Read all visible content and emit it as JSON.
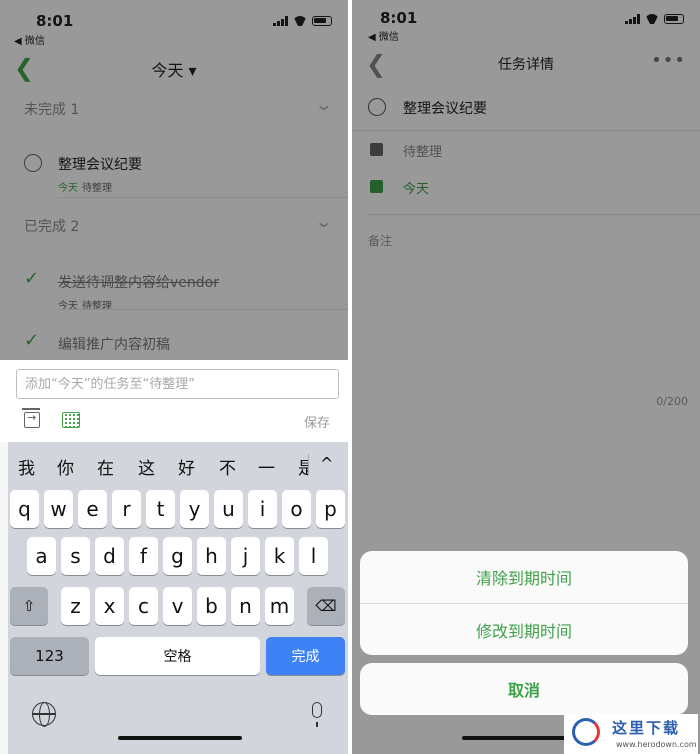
{
  "left": {
    "status": {
      "time": "8:01",
      "back_app": "◀ 微信"
    },
    "nav": {
      "title": "今天 ▾"
    },
    "sections": [
      {
        "label": "未完成 1"
      },
      {
        "label": "已完成 2"
      }
    ],
    "pending_tasks": [
      {
        "title": "整理会议纪要",
        "date": "今天",
        "list": "待整理"
      }
    ],
    "done_tasks": [
      {
        "title": "发送待调整内容给vendor",
        "date": "今天",
        "list": "待整理"
      },
      {
        "title": "编辑推广内容初稿"
      }
    ],
    "input": {
      "placeholder": "添加“今天”的任务至“待整理”"
    },
    "save_label": "保存",
    "keyboard": {
      "candidates": [
        "我",
        "你",
        "在",
        "这",
        "好",
        "不",
        "一",
        "是"
      ],
      "row1": [
        "q",
        "w",
        "e",
        "r",
        "t",
        "y",
        "u",
        "i",
        "o",
        "p"
      ],
      "row2": [
        "a",
        "s",
        "d",
        "f",
        "g",
        "h",
        "j",
        "k",
        "l"
      ],
      "row3": [
        "z",
        "x",
        "c",
        "v",
        "b",
        "n",
        "m"
      ],
      "shift": "⇧",
      "backspace": "⌫",
      "numbers": "123",
      "space": "空格",
      "done": "完成",
      "collapse": "^"
    }
  },
  "right": {
    "status": {
      "time": "8:01",
      "back_app": "◀ 微信"
    },
    "nav": {
      "title": "任务详情",
      "more": "•••"
    },
    "task": {
      "title": "整理会议纪要"
    },
    "list_name": "待整理",
    "due": "今天",
    "notes_label": "备注",
    "notes_count": "0/200",
    "sheet": {
      "clear": "清除到期时间",
      "modify": "修改到期时间",
      "cancel": "取消"
    },
    "accent": "#3fa14a"
  },
  "watermark": {
    "text": "这里下载",
    "url": "www.herodown.com"
  }
}
